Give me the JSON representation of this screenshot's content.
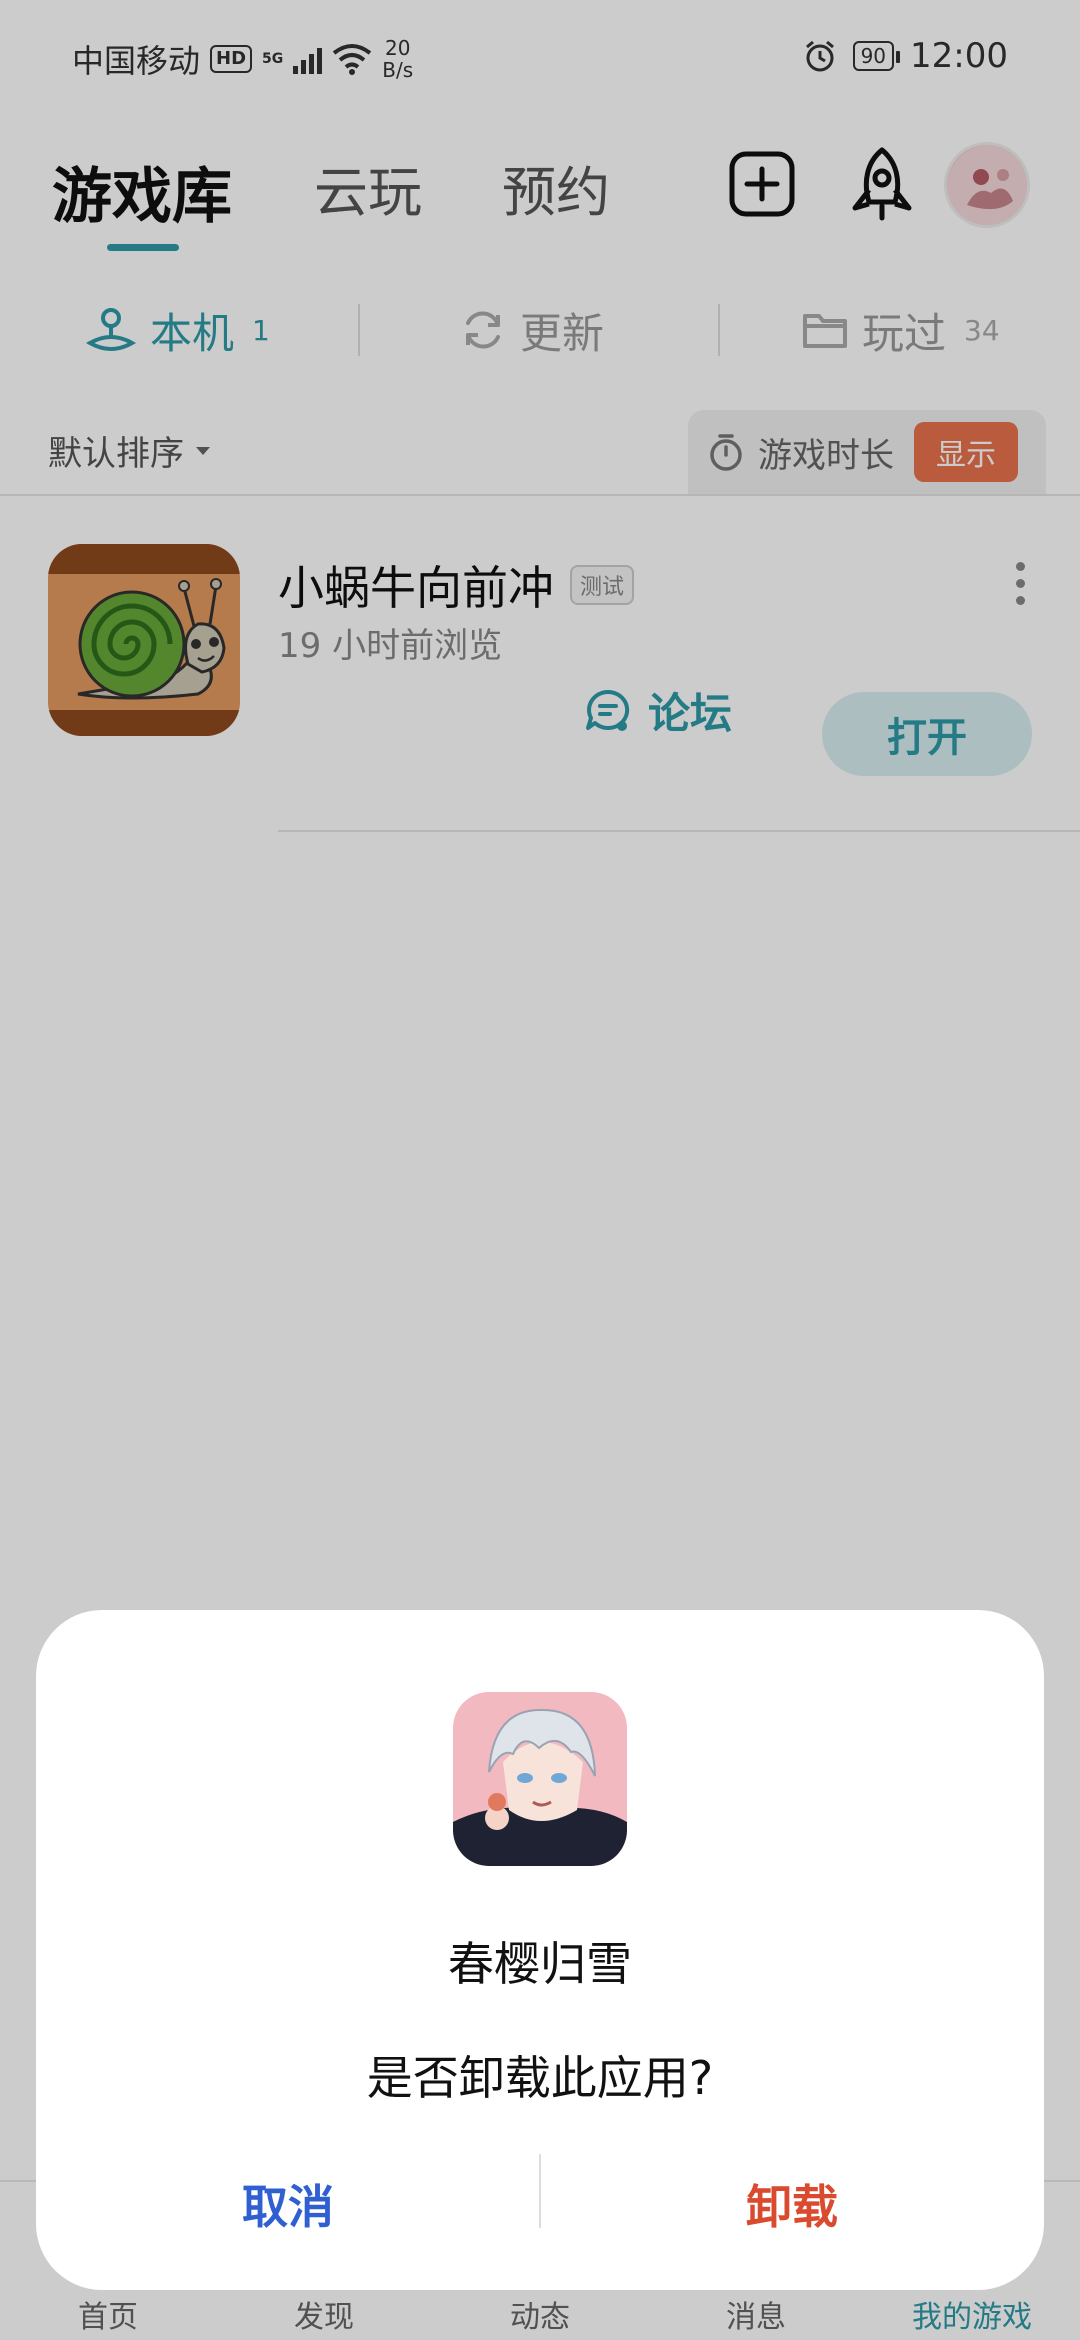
{
  "status_bar": {
    "carrier": "中国移动",
    "hd": "HD",
    "network": "5G",
    "speed_value": "20",
    "speed_unit": "B/s",
    "battery": "90",
    "time": "12:00"
  },
  "header": {
    "tabs": [
      "游戏库",
      "云玩",
      "预约"
    ],
    "active_tab": "游戏库"
  },
  "subtabs": {
    "local_label": "本机",
    "local_count": "1",
    "update_label": "更新",
    "played_label": "玩过",
    "played_count": "34"
  },
  "sortbar": {
    "sort_label": "默认排序",
    "playtime_label": "游戏时长",
    "show_label": "显示"
  },
  "game": {
    "title": "小蜗牛向前冲",
    "tag": "测试",
    "subtitle": "19 小时前浏览",
    "forum_label": "论坛",
    "open_label": "打开"
  },
  "bottom_nav": {
    "items": [
      "首页",
      "发现",
      "动态",
      "消息",
      "我的游戏"
    ],
    "active": "我的游戏"
  },
  "dialog": {
    "app_name": "春樱归雪",
    "message": "是否卸载此应用?",
    "cancel_label": "取消",
    "uninstall_label": "卸载"
  },
  "colors": {
    "accent": "#2e9aa8",
    "show_button": "#e8724b",
    "cancel": "#2f5fd1",
    "uninstall": "#d94a2f"
  }
}
